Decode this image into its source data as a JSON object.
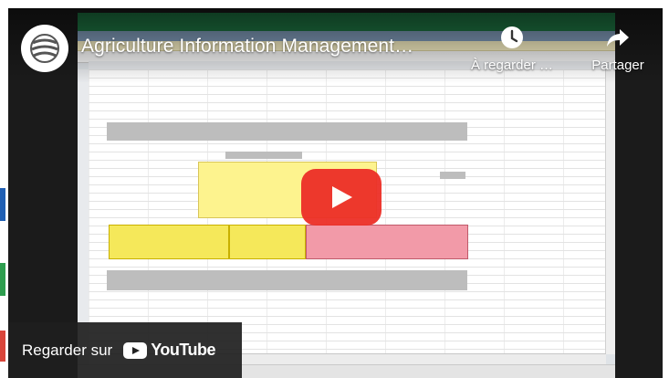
{
  "video": {
    "title": "Agriculture Information Management…"
  },
  "actions": {
    "watch_later_label": "À regarder …",
    "share_label": "Partager"
  },
  "watch_on": {
    "label": "Regarder sur",
    "brand": "YouTube"
  },
  "colors": {
    "play_button": "#ed2f27",
    "excel_green": "#1f7a45",
    "yellow_cells": "#f5e85a",
    "pink_cells": "#f29aa8"
  },
  "icons": {
    "channel_logo": "wto-globe-logo",
    "watch_later": "clock-icon",
    "share": "share-arrow-icon",
    "play": "play-icon",
    "youtube": "youtube-logo"
  }
}
